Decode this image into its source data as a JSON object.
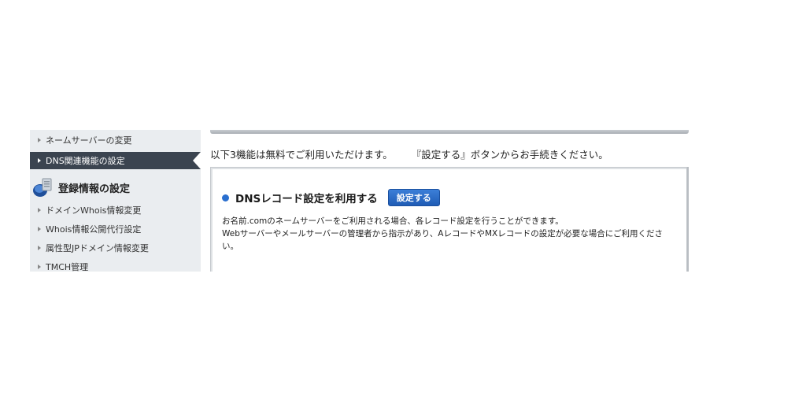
{
  "sidebar": {
    "items_top": [
      {
        "label": "ネームサーバーの変更"
      },
      {
        "label": "DNS関連機能の設定"
      }
    ],
    "section_heading": "登録情報の設定",
    "section_icon": "database-icon",
    "items_bottom": [
      {
        "label": "ドメインWhois情報変更"
      },
      {
        "label": "Whois情報公開代行設定"
      },
      {
        "label": "属性型JPドメイン情報変更"
      },
      {
        "label": "TMCH管理"
      }
    ]
  },
  "main": {
    "intro_part1": "以下3機能は無料でご利用いただけます。",
    "intro_part2": "『設定する』ボタンからお手続きください。",
    "panel": {
      "title": "DNSレコード設定を利用する",
      "button_label": "設定する",
      "desc_line1": "お名前.comのネームサーバーをご利用される場合、各レコード設定を行うことができます。",
      "desc_line2": "Webサーバーやメールサーバーの管理者から指示があり、AレコードやMXレコードの設定が必要な場合にご利用くださ",
      "desc_line3": "い。"
    }
  },
  "colors": {
    "sidebar_bg": "#eaedf0",
    "active_bg": "#3b4450",
    "accent_blue": "#2a6fcf"
  }
}
